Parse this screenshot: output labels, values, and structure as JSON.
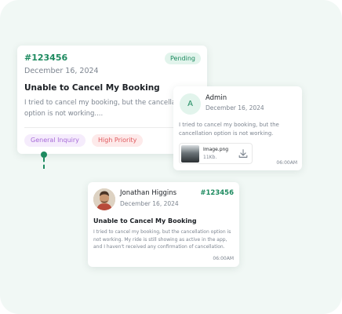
{
  "ticket": {
    "id": "#123456",
    "date": "December 16, 2024",
    "status": "Pending",
    "title": "Unable to Cancel My Booking",
    "description": "I tried to cancel my booking, but the cancellation option is not working....",
    "tags": [
      "General Inquiry",
      "High Priority"
    ]
  },
  "admin_reply": {
    "avatar_initial": "A",
    "name": "Admin",
    "date": "December 16, 2024",
    "message": "I tried to cancel my booking, but the cancellation option is not working.",
    "attachment": {
      "name": "Image.png",
      "size": "11Kb."
    },
    "time": "06:00AM"
  },
  "customer_message": {
    "name": "Jonathan Higgins",
    "date": "December 16, 2024",
    "ticket_id": "#123456",
    "title": "Unable to Cancel My Booking",
    "message": "I tried to cancel my booking, but the cancellation option is not working. My ride is still showing as active in the app, and I haven't received any confirmation of cancellation.",
    "time": "06:00AM"
  },
  "colors": {
    "accent": "#1d8a5f",
    "background": "#f1f8f5",
    "general_tag": "#a76ad8",
    "priority_tag": "#e0585d"
  },
  "icons": [
    "download-icon",
    "connector-dot-icon"
  ]
}
